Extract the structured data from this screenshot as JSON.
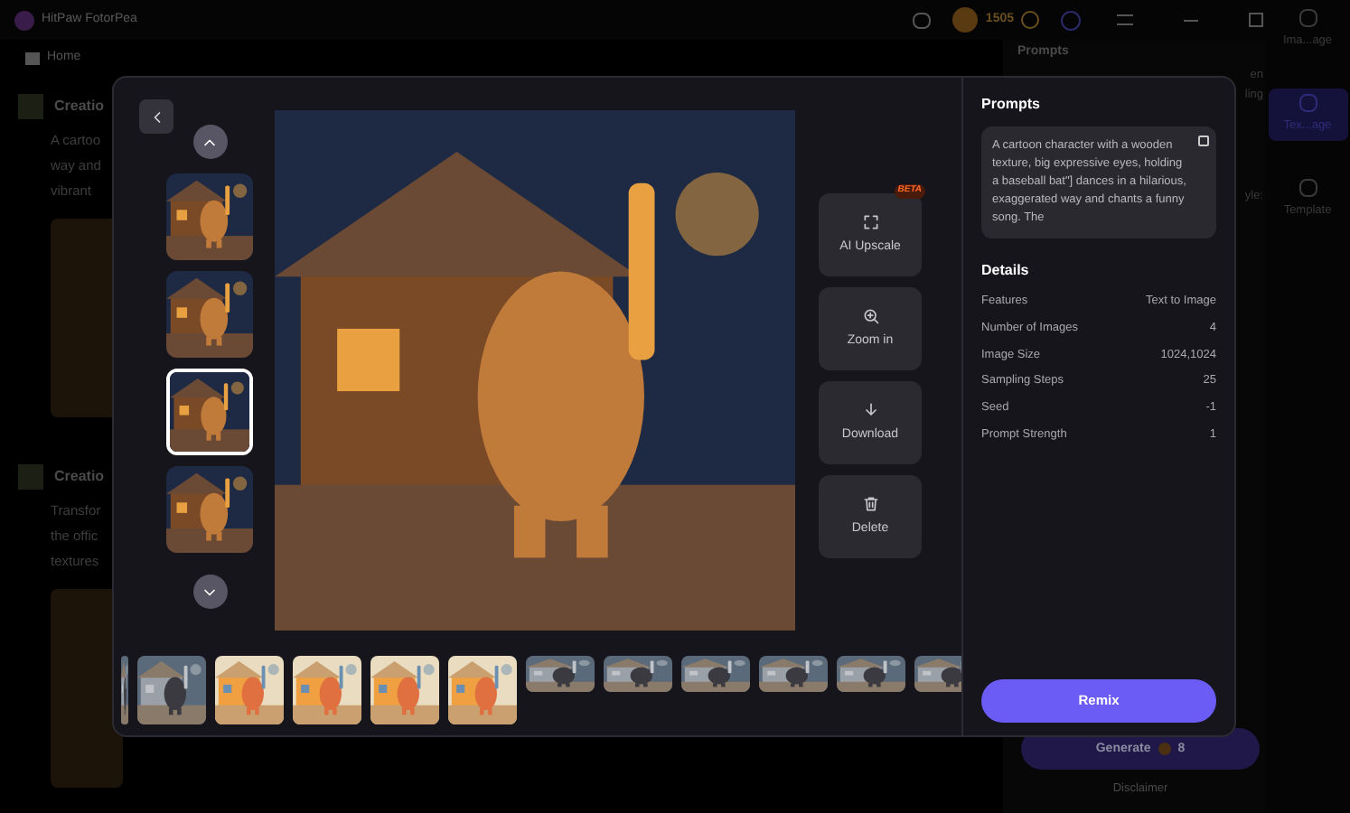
{
  "app": {
    "title": "HitPaw FotorPea",
    "credits": "1505",
    "nav": "Home",
    "panel_title": "Prompts",
    "panel_fragments": [
      "en",
      "ling",
      "yle:"
    ],
    "right_tabs": [
      {
        "label": "Ima...age",
        "selected": false
      },
      {
        "label": "Tex...age",
        "selected": true
      },
      {
        "label": "Template",
        "selected": false
      }
    ],
    "creations": [
      {
        "title": "Creatio",
        "lines": [
          "A cartoo",
          "way and",
          "vibrant"
        ]
      },
      {
        "title": "Creatio",
        "lines": [
          "Transfor",
          "the offic",
          "textures"
        ]
      }
    ],
    "generate": {
      "label": "Generate",
      "cost": "8"
    },
    "disclaimer": "Disclaimer"
  },
  "viewer": {
    "thumbnails": [
      {
        "kind": "picture",
        "selected": false
      },
      {
        "kind": "picture",
        "selected": false
      },
      {
        "kind": "picture",
        "selected": true
      },
      {
        "kind": "picture",
        "selected": false
      }
    ],
    "actions": [
      {
        "kind": "upscale",
        "label": "AI Upscale",
        "badge": "BETA"
      },
      {
        "kind": "zoom",
        "label": "Zoom in"
      },
      {
        "kind": "download",
        "label": "Download"
      },
      {
        "kind": "delete",
        "label": "Delete"
      }
    ],
    "prompts": {
      "title": "Prompts",
      "text": "A cartoon character with a wooden texture, big expressive eyes, holding a baseball bat\"] dances in a hilarious, exaggerated way and chants a funny song. The"
    },
    "details": {
      "title": "Details",
      "rows": [
        {
          "label": "Features",
          "value": "Text to Image"
        },
        {
          "label": "Number of Images",
          "value": "4"
        },
        {
          "label": "Image Size",
          "value": "1024,1024"
        },
        {
          "label": "Sampling Steps",
          "value": "25"
        },
        {
          "label": "Seed",
          "value": "-1"
        },
        {
          "label": "Prompt Strength",
          "value": "1"
        }
      ]
    },
    "remix": "Remix",
    "filmstrip": [
      {
        "kind": "picture"
      },
      {
        "kind": "picture"
      },
      {
        "kind": "picture"
      },
      {
        "kind": "picture"
      },
      {
        "kind": "picture"
      },
      {
        "kind": "picture"
      },
      {
        "kind": "picture"
      },
      {
        "kind": "picture"
      },
      {
        "kind": "picture"
      },
      {
        "kind": "picture"
      },
      {
        "kind": "picture"
      },
      {
        "kind": "picture"
      }
    ]
  }
}
